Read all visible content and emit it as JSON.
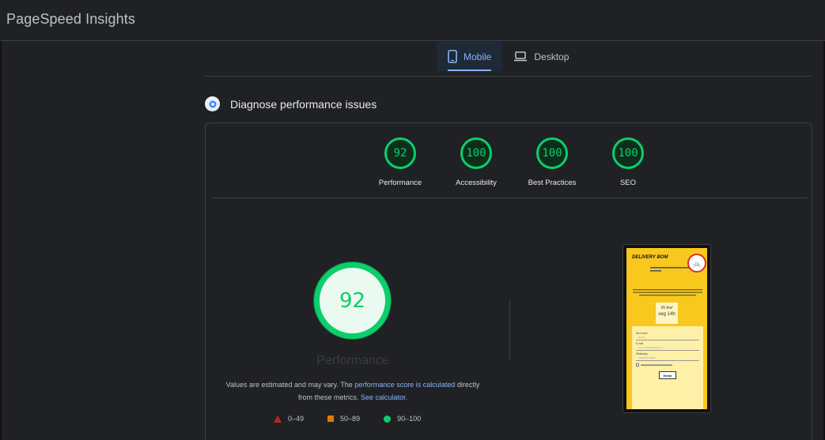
{
  "app": {
    "title": "PageSpeed Insights"
  },
  "tabs": [
    {
      "label": "Mobile",
      "icon": "mobile-phone-icon",
      "active": true
    },
    {
      "label": "Desktop",
      "icon": "laptop-icon",
      "active": false
    }
  ],
  "diagnose": {
    "title": "Diagnose performance issues"
  },
  "gauges": [
    {
      "score": "92",
      "label": "Performance"
    },
    {
      "score": "100",
      "label": "Accessibility"
    },
    {
      "score": "100",
      "label": "Best Practices"
    },
    {
      "score": "100",
      "label": "SEO"
    }
  ],
  "main_gauge": {
    "score": "92",
    "label": "Performance"
  },
  "explanation": {
    "prefix": "Values are estimated and may vary. The ",
    "link1": "performance score is calculated",
    "middle": " directly from these metrics. ",
    "link2": "See calculator."
  },
  "legend": [
    {
      "range": "0–49",
      "shape": "triangle",
      "color": "#c5221f"
    },
    {
      "range": "50–89",
      "shape": "square",
      "color": "#e67700"
    },
    {
      "range": "90–100",
      "shape": "circle",
      "color": "#0cce6b"
    }
  ],
  "screenshot": {
    "title": "DELIVERY BOM",
    "field_name": "Seu nome",
    "field_name_ph": "Nome",
    "field_email": "E-mail",
    "field_email_ph": "seu.e.mail@email.com",
    "field_whatsapp": "WhatsApp",
    "field_whatsapp_ph": "(00)00000-0000",
    "date_day": "26 fev/",
    "date_time": "seg 14h",
    "button": "Enviar"
  },
  "colors": {
    "pass": "#0cce6b",
    "average": "#e67700",
    "fail": "#c5221f",
    "link": "#8ab4f8"
  }
}
